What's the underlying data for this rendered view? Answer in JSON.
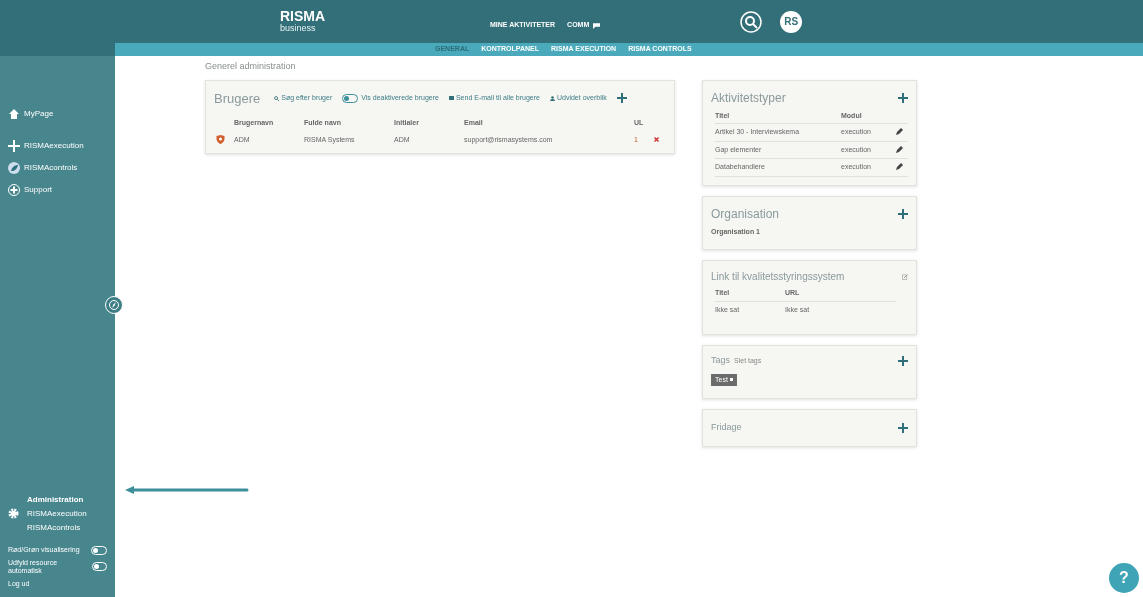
{
  "header": {
    "logo": "RISMA",
    "logo_sub": "business",
    "nav": [
      "MINE AKTIVITETER",
      "COMM"
    ],
    "avatar": "RS"
  },
  "tabs": [
    {
      "label": "GENERAL",
      "selected": true
    },
    {
      "label": "KONTROLPANEL",
      "selected": false
    },
    {
      "label": "RISMA EXECUTION",
      "selected": false
    },
    {
      "label": "RISMA CONTROLS",
      "selected": false
    }
  ],
  "sidebar": {
    "items": [
      {
        "label": "MyPage",
        "kind": "home"
      },
      {
        "label": "RISMAexecution",
        "kind": "execution"
      },
      {
        "label": "RISMAcontrols",
        "kind": "controls"
      },
      {
        "label": "Support",
        "kind": "support"
      }
    ],
    "admin_links": [
      {
        "label": "Administration",
        "selected": true
      },
      {
        "label": "RISMAexecution",
        "selected": false
      },
      {
        "label": "RISMAcontrols",
        "selected": false
      }
    ],
    "toggles": [
      {
        "label": "Rød/Grøn visualisering",
        "on": false
      },
      {
        "label": "Udfyld resource automatisk",
        "on": false
      }
    ],
    "logout": "Log ud"
  },
  "page_title": "Generel administration",
  "users": {
    "title": "Brugere",
    "search": "Søg efter bruger",
    "show_deactivated": {
      "label": "Vis deaktiverede brugere",
      "on": false
    },
    "email_all": "Send E-mail til alle brugere",
    "overview": "Udvidet overblik",
    "columns": [
      "Brugernavn",
      "Fulde navn",
      "Initialer",
      "Email",
      "UL"
    ],
    "rows": [
      {
        "cells": [
          "ADM",
          "RISMA Systems",
          "ADM",
          "support@rismasystems.com",
          "1"
        ]
      }
    ]
  },
  "activity_types": {
    "title": "Aktivitetstyper",
    "columns": [
      "Titel",
      "Modul"
    ],
    "rows": [
      [
        "Artikel 30 - Interviewskema",
        "execution"
      ],
      [
        "Gap elementer",
        "execution"
      ],
      [
        "Databehandlere",
        "execution"
      ]
    ]
  },
  "organisation": {
    "title": "Organisation",
    "items": [
      "Organisation 1"
    ]
  },
  "quality_link": {
    "title": "Link til kvalitetsstyringssystem",
    "columns": [
      "Titel",
      "URL"
    ],
    "rows": [
      [
        "Ikke sat",
        "Ikke sat"
      ]
    ]
  },
  "tags": {
    "title": "Tags",
    "delete_link": "Slet tags",
    "items": [
      "Test"
    ]
  },
  "holidays": {
    "title": "Fridage"
  },
  "help": "?"
}
